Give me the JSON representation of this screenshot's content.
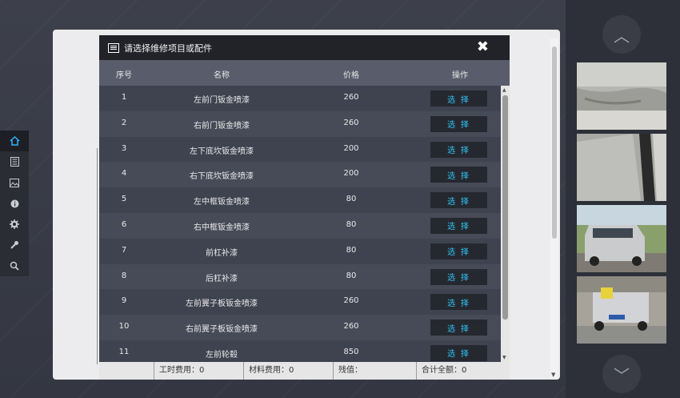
{
  "dialog": {
    "title": "请选择维修项目或配件",
    "close_label": "✖"
  },
  "columns": {
    "index": "序号",
    "name": "名称",
    "price": "价格",
    "action": "操作"
  },
  "rows": [
    {
      "index": "1",
      "name": "左前门钣金喷漆",
      "price": "260",
      "action": "选 择"
    },
    {
      "index": "2",
      "name": "右前门钣金喷漆",
      "price": "260",
      "action": "选 择"
    },
    {
      "index": "3",
      "name": "左下底坎钣金喷漆",
      "price": "200",
      "action": "选 择"
    },
    {
      "index": "4",
      "name": "右下底坎钣金喷漆",
      "price": "200",
      "action": "选 择"
    },
    {
      "index": "5",
      "name": "左中框钣金喷漆",
      "price": "80",
      "action": "选 择"
    },
    {
      "index": "6",
      "name": "右中框钣金喷漆",
      "price": "80",
      "action": "选 择"
    },
    {
      "index": "7",
      "name": "前杠补漆",
      "price": "80",
      "action": "选 择"
    },
    {
      "index": "8",
      "name": "后杠补漆",
      "price": "80",
      "action": "选 择"
    },
    {
      "index": "9",
      "name": "左前翼子板钣金喷漆",
      "price": "260",
      "action": "选 择"
    },
    {
      "index": "10",
      "name": "右前翼子板钣金喷漆",
      "price": "260",
      "action": "选 择"
    },
    {
      "index": "11",
      "name": "左前轮毂",
      "price": "850",
      "action": "选 择"
    }
  ],
  "footer": {
    "labor": "工时费用：0",
    "material": "材料费用：0",
    "residual": "残值：",
    "total": "合计全额：0"
  },
  "left_rail": {
    "icons": [
      "home-icon",
      "list-icon",
      "image-icon",
      "info-icon",
      "gear-icon",
      "tools-icon",
      "search-icon"
    ]
  },
  "gallery": {
    "nav_up": "︿",
    "nav_down": "﹀",
    "photos": [
      "car-door-dent-photo",
      "car-side-panel-photo",
      "minivan-front-photo",
      "pickup-rear-photo"
    ]
  },
  "colors": {
    "accent": "#2fc4f2",
    "dialog_bg": "#454956",
    "header_bg": "#212329"
  }
}
